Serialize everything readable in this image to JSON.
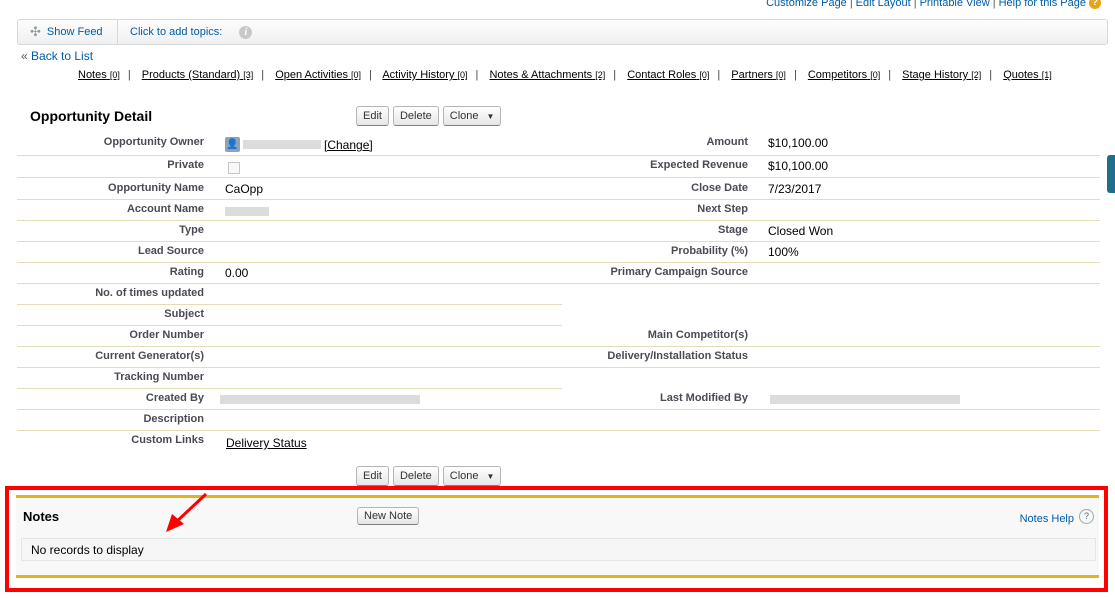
{
  "top_links": [
    "Customize Page",
    "Edit Layout",
    "Printable View",
    "Help for this Page"
  ],
  "feed": {
    "show_feed": "Show Feed",
    "topics": "Click to add topics:"
  },
  "back_to_list": "Back to List",
  "related": [
    {
      "label": "Notes",
      "count": "[0]"
    },
    {
      "label": "Products (Standard)",
      "count": "[3]"
    },
    {
      "label": "Open Activities",
      "count": "[0]"
    },
    {
      "label": "Activity History",
      "count": "[0]"
    },
    {
      "label": "Notes & Attachments",
      "count": "[2]"
    },
    {
      "label": "Contact Roles",
      "count": "[0]"
    },
    {
      "label": "Partners",
      "count": "[0]"
    },
    {
      "label": "Competitors",
      "count": "[0]"
    },
    {
      "label": "Stage History",
      "count": "[2]"
    },
    {
      "label": "Quotes",
      "count": "[1]"
    }
  ],
  "detail": {
    "title": "Opportunity Detail",
    "buttons": {
      "edit": "Edit",
      "delete": "Delete",
      "clone": "Clone"
    },
    "change_link": "[Change]",
    "labels_left": [
      "Opportunity Owner",
      "Private",
      "Opportunity Name",
      "Account Name",
      "Type",
      "Lead Source",
      "Rating",
      "No. of times updated",
      "Subject",
      "Order Number",
      "Current Generator(s)",
      "Tracking Number",
      "Created By",
      "Description",
      "Custom Links"
    ],
    "values_left": {
      "opportunity_name": "CaOpp",
      "rating": "0.00",
      "custom_link": "Delivery Status"
    },
    "labels_right": [
      "Amount",
      "Expected Revenue",
      "Close Date",
      "Next Step",
      "Stage",
      "Probability (%)",
      "Primary Campaign Source"
    ],
    "values_right": [
      "$10,100.00",
      "$10,100.00",
      "7/23/2017",
      "",
      "Closed Won",
      "100%",
      ""
    ],
    "label_main_competitor": "Main Competitor(s)",
    "label_delivery_status": "Delivery/Installation Status",
    "label_last_modified": "Last Modified By"
  },
  "notes": {
    "title": "Notes",
    "new_note": "New Note",
    "help": "Notes Help",
    "empty": "No records to display"
  }
}
